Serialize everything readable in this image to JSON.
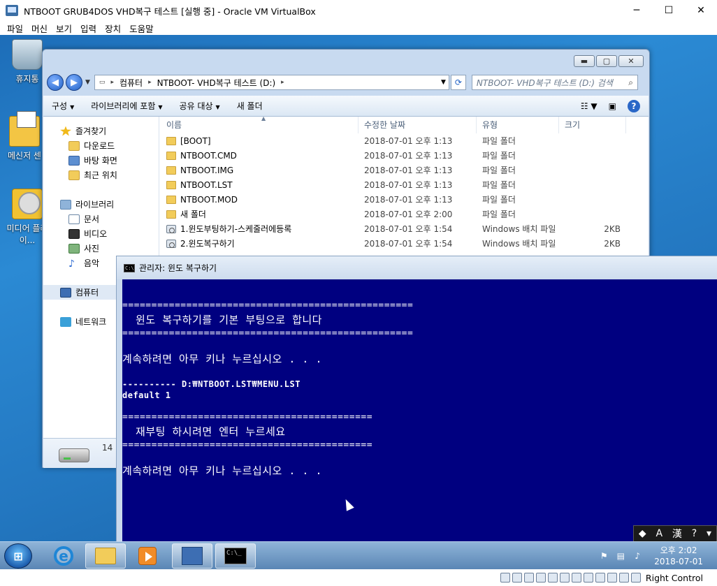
{
  "host": {
    "title": "NTBOOT GRUB4DOS VHD복구 테스트 [실행 중] - Oracle VM VirtualBox",
    "controls": {
      "minimize": "─",
      "maximize": "☐",
      "close": "✕"
    },
    "menu": [
      "파일",
      "머신",
      "보기",
      "입력",
      "장치",
      "도움말"
    ],
    "host_key": "Right Control"
  },
  "desktop": {
    "icons": [
      {
        "label": "휴지통"
      },
      {
        "label": "메신저 센"
      },
      {
        "label": "미디어 플레이..."
      }
    ]
  },
  "explorer": {
    "controls": {
      "minimize": "▬",
      "maximize": "▢",
      "close": "✕"
    },
    "address": {
      "crumbs": [
        "컴퓨터",
        "NTBOOT- VHD복구 테스트 (D:)"
      ]
    },
    "search_placeholder": "NTBOOT- VHD복구 테스트 (D:) 검색",
    "toolbar": {
      "organize": "구성",
      "include_library": "라이브러리에 포함",
      "share": "공유 대상",
      "new_folder": "새 폴더"
    },
    "nav": {
      "favorites": "즐겨찾기",
      "favorites_items": [
        "다운로드",
        "바탕 화면",
        "최근 위치"
      ],
      "libraries": "라이브러리",
      "libraries_items": [
        "문서",
        "비디오",
        "사진",
        "음악"
      ],
      "computer": "컴퓨터",
      "network": "네트워크"
    },
    "columns": {
      "name": "이름",
      "date": "수정한 날짜",
      "type": "유형",
      "size": "크기"
    },
    "files": [
      {
        "name": "[BOOT]",
        "date": "2018-07-01 오후 1:13",
        "type": "파일 폴더",
        "size": "",
        "kind": "folder"
      },
      {
        "name": "NTBOOT.CMD",
        "date": "2018-07-01 오후 1:13",
        "type": "파일 폴더",
        "size": "",
        "kind": "folder"
      },
      {
        "name": "NTBOOT.IMG",
        "date": "2018-07-01 오후 1:13",
        "type": "파일 폴더",
        "size": "",
        "kind": "folder"
      },
      {
        "name": "NTBOOT.LST",
        "date": "2018-07-01 오후 1:13",
        "type": "파일 폴더",
        "size": "",
        "kind": "folder"
      },
      {
        "name": "NTBOOT.MOD",
        "date": "2018-07-01 오후 1:13",
        "type": "파일 폴더",
        "size": "",
        "kind": "folder"
      },
      {
        "name": "새 폴더",
        "date": "2018-07-01 오후 2:00",
        "type": "파일 폴더",
        "size": "",
        "kind": "folder"
      },
      {
        "name": "1.윈도부팅하기-스케줄러에등록",
        "date": "2018-07-01 오후 1:54",
        "type": "Windows 배치 파일",
        "size": "2KB",
        "kind": "batch"
      },
      {
        "name": "2.윈도복구하기",
        "date": "2018-07-01 오후 1:54",
        "type": "Windows 배치 파일",
        "size": "2KB",
        "kind": "batch"
      }
    ],
    "details_count": "14"
  },
  "console": {
    "title": "관리자:  윈도 복구하기",
    "lines": [
      "==================================================",
      "  윈도 복구하기를 기본 부팅으로 합니다",
      "==================================================",
      "",
      "계속하려면 아무 키나 누르십시오 . . .",
      "",
      "---------- D:₩NTBOOT.LST₩MENU.LST",
      "default 1",
      "",
      "===========================================",
      "  재부팅 하시려면 엔터 누르세요",
      "===========================================",
      "",
      "계속하려면 아무 키나 누르십시오 . . ."
    ]
  },
  "langbar": {
    "mode": "A",
    "hanja": "漢",
    "help": "?"
  },
  "taskbar": {
    "clock_time": "오후 2:02",
    "clock_date": "2018-07-01"
  }
}
